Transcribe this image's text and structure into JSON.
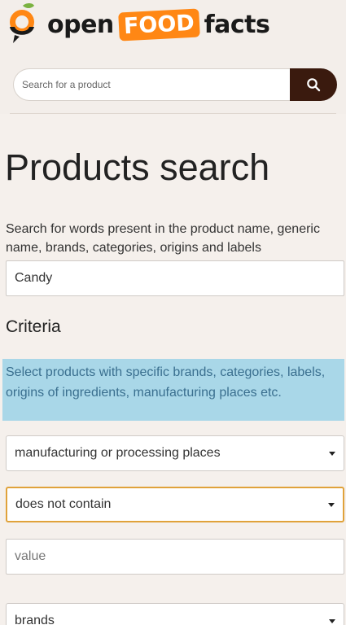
{
  "header": {
    "logo": {
      "open": "open",
      "food": "FOOD",
      "facts": "facts"
    },
    "search": {
      "placeholder": "Search for a product",
      "button_icon": "search-icon"
    }
  },
  "main": {
    "title": "Products search",
    "intro": "Search for words present in the product name, generic name, brands, categories, origins and labels",
    "search_terms_value": "Candy",
    "criteria_heading": "Criteria",
    "criteria_help": "Select products with specific brands, categories, labels, origins of ingredients, manufacturing places etc.",
    "criteria": [
      {
        "field": "manufacturing or processing places",
        "operator": "does not contain",
        "value_placeholder": "value"
      },
      {
        "field": "brands"
      }
    ]
  },
  "colors": {
    "brand_orange": "#ff8714",
    "search_button": "#3a1a0e",
    "help_background": "#a9d7e8",
    "focus_border": "#e0a23a"
  }
}
